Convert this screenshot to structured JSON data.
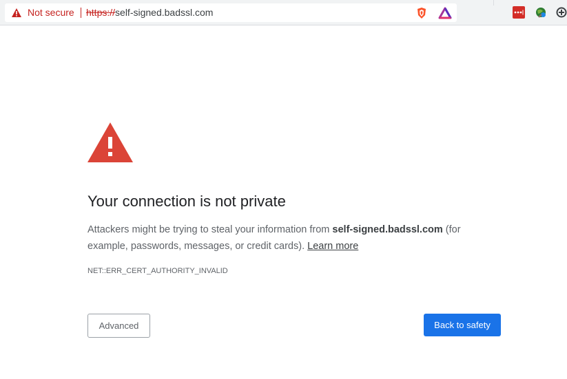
{
  "toolbar": {
    "security_label": "Not secure",
    "url_scheme": "https://",
    "url_rest": "self-signed.badssl.com",
    "icons": [
      "warning-icon",
      "brave-shield-icon",
      "brave-rewards-icon",
      "lastpass-icon",
      "globe-extension-icon",
      "extension-icon"
    ]
  },
  "main": {
    "heading": "Your connection is not private",
    "explain_prefix": "Attackers might be trying to steal your information from ",
    "explain_host": "self-signed.badssl.com",
    "explain_suffix": " (for example, passwords, messages, or credit cards). ",
    "learn_more": "Learn more",
    "error_code": "NET::ERR_CERT_AUTHORITY_INVALID",
    "advanced_button": "Advanced",
    "back_button": "Back to safety"
  },
  "colors": {
    "warning_red": "#db4437",
    "not_secure_red": "#c5221f",
    "primary_blue": "#1a73e8"
  }
}
